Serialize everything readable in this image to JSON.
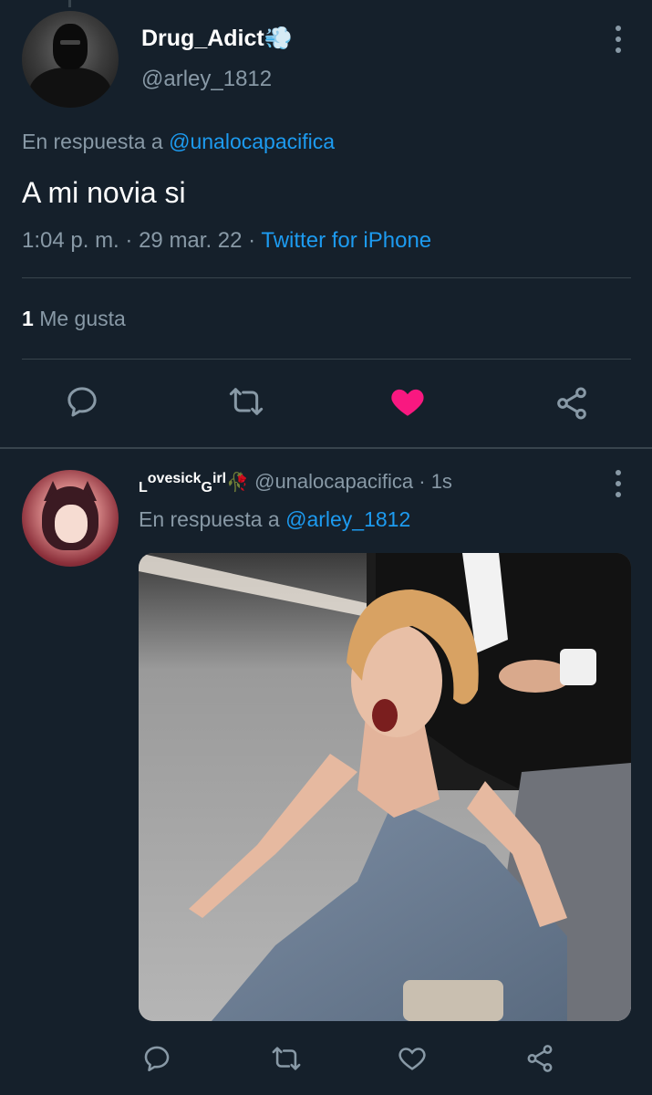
{
  "main_tweet": {
    "display_name": "Drug_Adict💨",
    "handle": "@arley_1812",
    "reply_prefix": "En respuesta a",
    "reply_to": "@unalocapacifica",
    "text": "A mi novia si",
    "time": "1:04 p. m.",
    "date": "29 mar. 22",
    "source": "Twitter for iPhone",
    "likes_count": "1",
    "likes_label": "Me gusta",
    "liked": true
  },
  "reply_tweet": {
    "display_name_parts": [
      "L",
      "ovesick",
      "G",
      "irl"
    ],
    "display_name_suffix": "🥀",
    "handle": "@unalocapacifica",
    "age": "1s",
    "reply_prefix": "En respuesta a",
    "reply_to": "@arley_1812",
    "media_description": "woman-in-blue-gown-reacting"
  },
  "icons": {
    "reply": "reply-icon",
    "retweet": "retweet-icon",
    "like": "heart-icon",
    "share": "share-icon",
    "more": "more-vertical-icon"
  },
  "colors": {
    "background": "#15202b",
    "text": "#ffffff",
    "secondary": "#8899a6",
    "link": "#1d9bf0",
    "like_active": "#f91880",
    "divider": "#38444d"
  }
}
